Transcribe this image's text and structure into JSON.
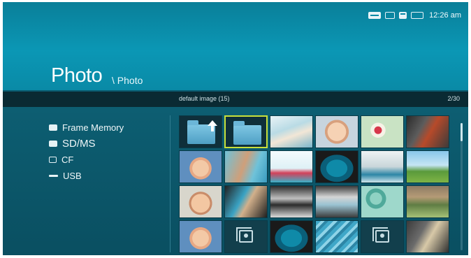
{
  "status": {
    "icons": [
      "usb-icon",
      "cf-card-icon",
      "sd-card-icon",
      "frame-memory-icon"
    ],
    "time": "12:26 am"
  },
  "header": {
    "title": "Photo",
    "breadcrumb": "\\ Photo"
  },
  "info_bar": {
    "folder_caption": "default image (15)",
    "page_counter": "2/30"
  },
  "sources": [
    {
      "label": "Frame Memory",
      "icon": "frame-memory-icon"
    },
    {
      "label": "SD/MS",
      "icon": "sd-card-icon",
      "selected": true
    },
    {
      "label": "CF",
      "icon": "cf-card-icon"
    },
    {
      "label": "USB",
      "icon": "usb-icon"
    }
  ],
  "thumbnails": [
    {
      "kind": "folder-up",
      "style": "folder"
    },
    {
      "kind": "folder",
      "style": "folder",
      "selected": true
    },
    {
      "kind": "photo",
      "style": "ph-bed"
    },
    {
      "kind": "photo",
      "style": "ph-baby2"
    },
    {
      "kind": "photo",
      "style": "ph-fruit"
    },
    {
      "kind": "photo",
      "style": "ph-car"
    },
    {
      "kind": "photo",
      "style": "ph-baby"
    },
    {
      "kind": "photo",
      "style": "ph-legs"
    },
    {
      "kind": "photo",
      "style": "ph-flask"
    },
    {
      "kind": "photo",
      "style": "ph-lips"
    },
    {
      "kind": "photo",
      "style": "ph-sculpt"
    },
    {
      "kind": "photo",
      "style": "ph-tree"
    },
    {
      "kind": "photo",
      "style": "ph-baby3"
    },
    {
      "kind": "photo",
      "style": "ph-swim"
    },
    {
      "kind": "photo",
      "style": "ph-walk"
    },
    {
      "kind": "photo",
      "style": "ph-window"
    },
    {
      "kind": "photo",
      "style": "ph-eggs"
    },
    {
      "kind": "photo",
      "style": "ph-field"
    },
    {
      "kind": "photo",
      "style": "ph-baby"
    },
    {
      "kind": "placeholder",
      "style": "placeholder"
    },
    {
      "kind": "photo",
      "style": "ph-lips"
    },
    {
      "kind": "photo",
      "style": "ph-pool"
    },
    {
      "kind": "placeholder",
      "style": "placeholder"
    },
    {
      "kind": "photo",
      "style": "ph-room"
    }
  ],
  "colors": {
    "header": "#0a8aa6",
    "body": "#0b5a6f",
    "info_bar": "#0a2a33",
    "selection": "#c8e03a"
  }
}
